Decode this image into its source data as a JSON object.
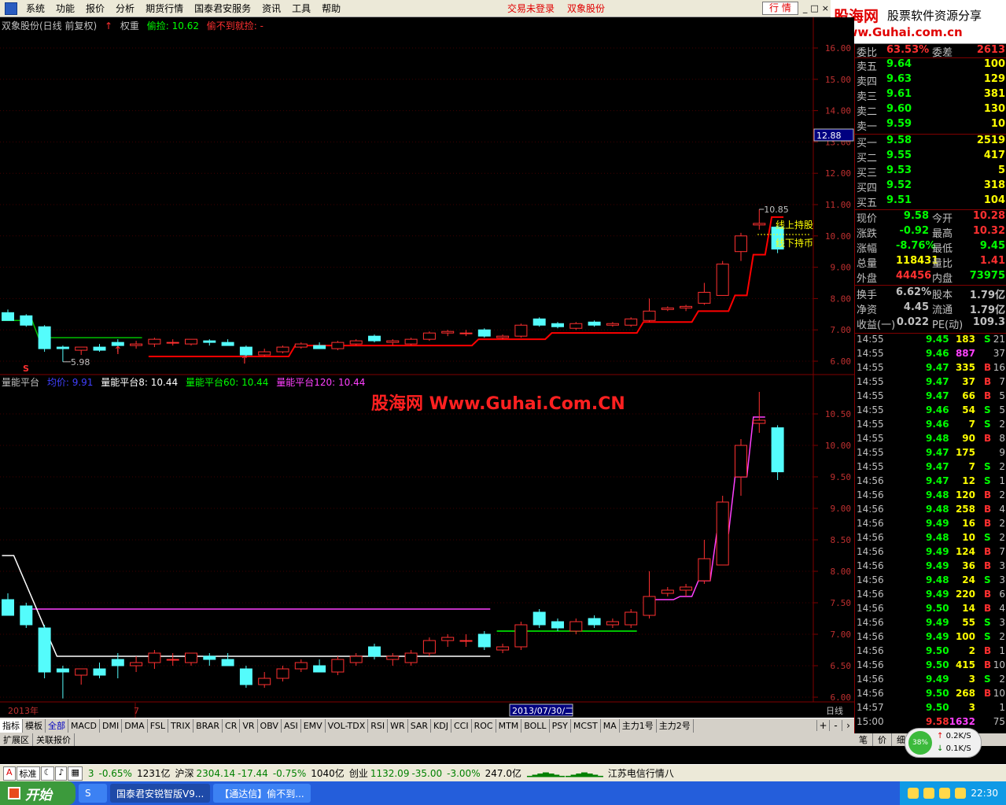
{
  "menu": {
    "items": [
      "系统",
      "功能",
      "报价",
      "分析",
      "期货行情",
      "国泰君安服务",
      "资讯",
      "工具",
      "帮助"
    ],
    "status_login": "交易未登录",
    "status_stock": "双象股份",
    "hq_button": "行 情",
    "win_controls": [
      "_",
      "□",
      "×"
    ]
  },
  "logo": {
    "line1_brand": "股海网",
    "line1_tag": "股票软件资源分享",
    "line2_url": "Www.Guhai.com.cn"
  },
  "main_header": {
    "title": "双象股份(日线 前复权)",
    "weight_label": "权重",
    "indicator1": "偷捡: 10.62",
    "indicator2": "偷不到就捡: -"
  },
  "sub_header": {
    "name": "量能平台",
    "avg": "均价: 9.91",
    "p8": "量能平台8: 10.44",
    "p60": "量能平台60: 10.44",
    "p120": "量能平台120: 10.44"
  },
  "watermark": "股海网 Www.Guhai.Com.CN",
  "annotations": {
    "above_line": "线上持股",
    "below_line": "线下持币",
    "high_label": "10.85",
    "low_label": "5.98",
    "s_marker": "S",
    "price_tag": "12.88"
  },
  "time_axis": {
    "labels": [
      "2013年",
      "7",
      "2013/07/30/二"
    ],
    "period": "日线"
  },
  "chart_data": {
    "type": "candlestick",
    "title": "双象股份(日线 前复权)",
    "main_y_ticks": [
      6.0,
      7.0,
      8.0,
      9.0,
      10.0,
      11.0,
      12.0,
      13.0,
      14.0,
      15.0,
      16.0
    ],
    "sub_y_ticks": [
      6.0,
      6.5,
      7.0,
      7.5,
      8.0,
      8.5,
      9.0,
      9.5,
      10.0,
      10.5
    ],
    "candles": [
      {
        "o": 7.55,
        "h": 7.65,
        "l": 7.3,
        "c": 7.3
      },
      {
        "o": 7.45,
        "h": 7.5,
        "l": 7.1,
        "c": 7.15
      },
      {
        "o": 7.1,
        "h": 7.15,
        "l": 6.3,
        "c": 6.4
      },
      {
        "o": 6.45,
        "h": 6.5,
        "l": 5.98,
        "c": 6.4
      },
      {
        "o": 6.35,
        "h": 6.45,
        "l": 6.2,
        "c": 6.45
      },
      {
        "o": 6.45,
        "h": 6.55,
        "l": 6.3,
        "c": 6.35
      },
      {
        "o": 6.6,
        "h": 6.7,
        "l": 6.3,
        "c": 6.5
      },
      {
        "o": 6.5,
        "h": 6.65,
        "l": 6.4,
        "c": 6.55
      },
      {
        "o": 6.55,
        "h": 6.75,
        "l": 6.45,
        "c": 6.7
      },
      {
        "o": 6.6,
        "h": 6.7,
        "l": 6.5,
        "c": 6.6
      },
      {
        "o": 6.55,
        "h": 6.65,
        "l": 6.5,
        "c": 6.7
      },
      {
        "o": 6.65,
        "h": 6.7,
        "l": 6.5,
        "c": 6.6
      },
      {
        "o": 6.6,
        "h": 6.7,
        "l": 6.55,
        "c": 6.5
      },
      {
        "o": 6.45,
        "h": 6.5,
        "l": 6.15,
        "c": 6.2
      },
      {
        "o": 6.2,
        "h": 6.4,
        "l": 6.15,
        "c": 6.3
      },
      {
        "o": 6.3,
        "h": 6.5,
        "l": 6.25,
        "c": 6.45
      },
      {
        "o": 6.45,
        "h": 6.6,
        "l": 6.4,
        "c": 6.55
      },
      {
        "o": 6.5,
        "h": 6.6,
        "l": 6.4,
        "c": 6.4
      },
      {
        "o": 6.4,
        "h": 6.65,
        "l": 6.35,
        "c": 6.6
      },
      {
        "o": 6.55,
        "h": 6.7,
        "l": 6.5,
        "c": 6.65
      },
      {
        "o": 6.8,
        "h": 6.85,
        "l": 6.6,
        "c": 6.65
      },
      {
        "o": 6.6,
        "h": 6.7,
        "l": 6.5,
        "c": 6.65
      },
      {
        "o": 6.55,
        "h": 6.75,
        "l": 6.5,
        "c": 6.7
      },
      {
        "o": 6.7,
        "h": 6.95,
        "l": 6.65,
        "c": 6.9
      },
      {
        "o": 6.9,
        "h": 7.0,
        "l": 6.8,
        "c": 6.95
      },
      {
        "o": 6.9,
        "h": 7.0,
        "l": 6.8,
        "c": 6.9
      },
      {
        "o": 7.0,
        "h": 7.05,
        "l": 6.75,
        "c": 6.8
      },
      {
        "o": 6.75,
        "h": 6.85,
        "l": 6.7,
        "c": 6.8
      },
      {
        "o": 6.8,
        "h": 7.2,
        "l": 6.75,
        "c": 7.15
      },
      {
        "o": 7.35,
        "h": 7.4,
        "l": 7.1,
        "c": 7.15
      },
      {
        "o": 7.2,
        "h": 7.25,
        "l": 7.05,
        "c": 7.1
      },
      {
        "o": 7.05,
        "h": 7.25,
        "l": 7.0,
        "c": 7.2
      },
      {
        "o": 7.25,
        "h": 7.3,
        "l": 7.1,
        "c": 7.15
      },
      {
        "o": 7.15,
        "h": 7.25,
        "l": 7.1,
        "c": 7.2
      },
      {
        "o": 7.15,
        "h": 7.4,
        "l": 7.1,
        "c": 7.35
      },
      {
        "o": 7.3,
        "h": 8.0,
        "l": 7.25,
        "c": 7.6
      },
      {
        "o": 7.65,
        "h": 7.75,
        "l": 7.6,
        "c": 7.7
      },
      {
        "o": 7.7,
        "h": 7.8,
        "l": 7.6,
        "c": 7.75
      },
      {
        "o": 7.85,
        "h": 8.5,
        "l": 7.8,
        "c": 8.2
      },
      {
        "o": 8.1,
        "h": 9.2,
        "l": 8.1,
        "c": 9.1
      },
      {
        "o": 9.5,
        "h": 10.1,
        "l": 9.2,
        "c": 10.0
      },
      {
        "o": 10.35,
        "h": 10.85,
        "l": 10.2,
        "c": 10.4
      },
      {
        "o": 10.28,
        "h": 10.32,
        "l": 9.45,
        "c": 9.58
      }
    ],
    "series": [
      {
        "name": "偷捡",
        "color": "#ff0000"
      },
      {
        "name": "量能平台8",
        "color": "#ffffff"
      },
      {
        "name": "量能平台60",
        "color": "#00ff00"
      },
      {
        "name": "量能平台120",
        "color": "#ff00ff"
      }
    ]
  },
  "quote": {
    "weibi_label": "委比",
    "weibi_value": "63.53%",
    "weicha_label": "委差",
    "weicha_value": "2613",
    "asks": [
      {
        "label": "卖五",
        "price": "9.64",
        "vol": "100"
      },
      {
        "label": "卖四",
        "price": "9.63",
        "vol": "129"
      },
      {
        "label": "卖三",
        "price": "9.61",
        "vol": "381"
      },
      {
        "label": "卖二",
        "price": "9.60",
        "vol": "130"
      },
      {
        "label": "卖一",
        "price": "9.59",
        "vol": "10"
      }
    ],
    "bids": [
      {
        "label": "买一",
        "price": "9.58",
        "vol": "2519"
      },
      {
        "label": "买二",
        "price": "9.55",
        "vol": "417"
      },
      {
        "label": "买三",
        "price": "9.53",
        "vol": "5"
      },
      {
        "label": "买四",
        "price": "9.52",
        "vol": "318"
      },
      {
        "label": "买五",
        "price": "9.51",
        "vol": "104"
      }
    ],
    "stats": [
      {
        "l1": "现价",
        "v1": "9.58",
        "c1": "#00ff00",
        "l2": "今开",
        "v2": "10.28",
        "c2": "#ff3030"
      },
      {
        "l1": "涨跌",
        "v1": "-0.92",
        "c1": "#00ff00",
        "l2": "最高",
        "v2": "10.32",
        "c2": "#ff3030"
      },
      {
        "l1": "涨幅",
        "v1": "-8.76%",
        "c1": "#00ff00",
        "l2": "最低",
        "v2": "9.45",
        "c2": "#00ff00"
      },
      {
        "l1": "总量",
        "v1": "118431",
        "c1": "#ffff00",
        "l2": "量比",
        "v2": "1.41",
        "c2": "#ff3030"
      },
      {
        "l1": "外盘",
        "v1": "44456",
        "c1": "#ff3030",
        "l2": "内盘",
        "v2": "73975",
        "c2": "#00ff00"
      },
      {
        "l1": "换手",
        "v1": "6.62%",
        "c1": "#c0c0c0",
        "l2": "股本",
        "v2": "1.79亿",
        "c2": "#c0c0c0"
      },
      {
        "l1": "净资",
        "v1": "4.45",
        "c1": "#c0c0c0",
        "l2": "流通",
        "v2": "1.79亿",
        "c2": "#c0c0c0"
      },
      {
        "l1": "收益(一)",
        "v1": "0.022",
        "c1": "#c0c0c0",
        "l2": "PE(动)",
        "v2": "109.3",
        "c2": "#c0c0c0"
      }
    ]
  },
  "ticks": [
    {
      "t": "14:55",
      "p": "9.45",
      "v": "183",
      "d": "S",
      "c": "21"
    },
    {
      "t": "14:55",
      "p": "9.46",
      "v": "887",
      "d": "",
      "c": "37"
    },
    {
      "t": "14:55",
      "p": "9.47",
      "v": "335",
      "d": "B",
      "c": "16"
    },
    {
      "t": "14:55",
      "p": "9.47",
      "v": "37",
      "d": "B",
      "c": "7"
    },
    {
      "t": "14:55",
      "p": "9.47",
      "v": "66",
      "d": "B",
      "c": "5"
    },
    {
      "t": "14:55",
      "p": "9.46",
      "v": "54",
      "d": "S",
      "c": "5"
    },
    {
      "t": "14:55",
      "p": "9.46",
      "v": "7",
      "d": "S",
      "c": "2"
    },
    {
      "t": "14:55",
      "p": "9.48",
      "v": "90",
      "d": "B",
      "c": "8"
    },
    {
      "t": "14:55",
      "p": "9.47",
      "v": "175",
      "d": "",
      "c": "9"
    },
    {
      "t": "14:55",
      "p": "9.47",
      "v": "7",
      "d": "S",
      "c": "2"
    },
    {
      "t": "14:56",
      "p": "9.47",
      "v": "12",
      "d": "S",
      "c": "1"
    },
    {
      "t": "14:56",
      "p": "9.48",
      "v": "120",
      "d": "B",
      "c": "2"
    },
    {
      "t": "14:56",
      "p": "9.48",
      "v": "258",
      "d": "B",
      "c": "4"
    },
    {
      "t": "14:56",
      "p": "9.49",
      "v": "16",
      "d": "B",
      "c": "2"
    },
    {
      "t": "14:56",
      "p": "9.48",
      "v": "10",
      "d": "S",
      "c": "2"
    },
    {
      "t": "14:56",
      "p": "9.49",
      "v": "124",
      "d": "B",
      "c": "7"
    },
    {
      "t": "14:56",
      "p": "9.49",
      "v": "36",
      "d": "B",
      "c": "3"
    },
    {
      "t": "14:56",
      "p": "9.48",
      "v": "24",
      "d": "S",
      "c": "3"
    },
    {
      "t": "14:56",
      "p": "9.49",
      "v": "220",
      "d": "B",
      "c": "6"
    },
    {
      "t": "14:56",
      "p": "9.50",
      "v": "14",
      "d": "B",
      "c": "4"
    },
    {
      "t": "14:56",
      "p": "9.49",
      "v": "55",
      "d": "S",
      "c": "3"
    },
    {
      "t": "14:56",
      "p": "9.49",
      "v": "100",
      "d": "S",
      "c": "2"
    },
    {
      "t": "14:56",
      "p": "9.50",
      "v": "2",
      "d": "B",
      "c": "1"
    },
    {
      "t": "14:56",
      "p": "9.50",
      "v": "415",
      "d": "B",
      "c": "10"
    },
    {
      "t": "14:56",
      "p": "9.49",
      "v": "3",
      "d": "S",
      "c": "2"
    },
    {
      "t": "14:56",
      "p": "9.50",
      "v": "268",
      "d": "B",
      "c": "10"
    },
    {
      "t": "14:57",
      "p": "9.50",
      "v": "3",
      "d": "",
      "c": "1"
    },
    {
      "t": "15:00",
      "p": "9.58",
      "v": "1632",
      "d": "",
      "c": "75"
    }
  ],
  "indicator_tabs": [
    "指标",
    "模板",
    "全部",
    "MACD",
    "DMI",
    "DMA",
    "FSL",
    "TRIX",
    "BRAR",
    "CR",
    "VR",
    "OBV",
    "ASI",
    "EMV",
    "VOL-TDX",
    "RSI",
    "WR",
    "SAR",
    "KDJ",
    "CCI",
    "ROC",
    "MTM",
    "BOLL",
    "PSY",
    "MCST",
    "MA",
    "主力1号",
    "主力2号"
  ],
  "ext_tabs": [
    "扩展区",
    "关联报价"
  ],
  "panel_tabs": [
    "笔",
    "价",
    "细"
  ],
  "speed": {
    "pct": "38%",
    "up": "0.2K/S",
    "down": "0.1K/S"
  },
  "statusline": {
    "mode": "标准",
    "sh_chg": "3",
    "sh_pct": "-0.65%",
    "sh_amt": "1231亿",
    "sz_label": "沪深",
    "sz_val": "2304.14",
    "sz_chg": "-17.44",
    "sz_pct": "-0.75%",
    "sz_amt": "1040亿",
    "cy_label": "创业",
    "cy_val": "1132.09",
    "cy_chg": "-35.00",
    "cy_pct": "-3.00%",
    "cy_amt": "247.0亿",
    "news": "江苏电信行情八"
  },
  "taskbar": {
    "start": "开始",
    "tasks": [
      "国泰君安锐智版V9...",
      "【通达信】偷不到..."
    ],
    "clock": "22:30"
  }
}
